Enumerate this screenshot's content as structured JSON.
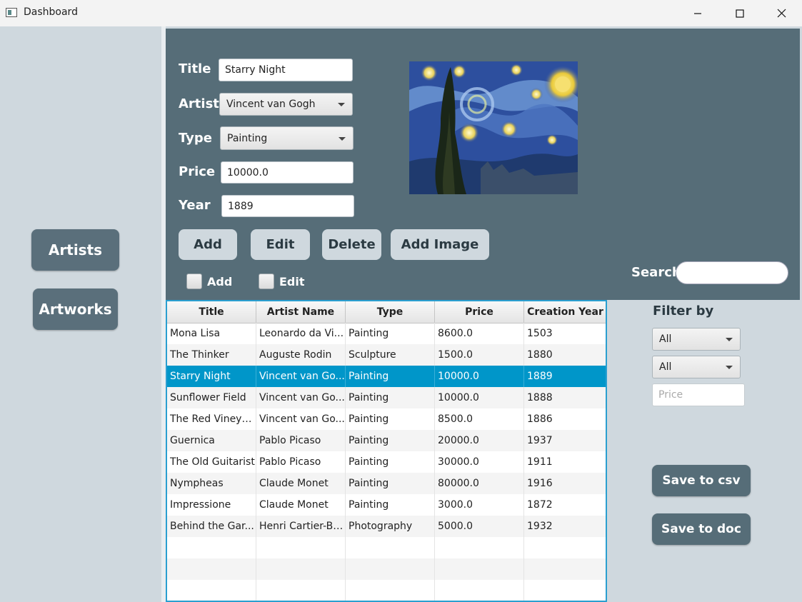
{
  "window": {
    "title": "Dashboard"
  },
  "sidebar": {
    "artists_label": "Artists",
    "artworks_label": "Artworks"
  },
  "form": {
    "title_label": "Title",
    "title_value": "Starry Night",
    "artist_label": "Artist",
    "artist_value": "Vincent van Gogh",
    "type_label": "Type",
    "type_value": "Painting",
    "price_label": "Price",
    "price_value": "10000.0",
    "year_label": "Year",
    "year_value": "1889"
  },
  "actions": {
    "add": "Add",
    "edit": "Edit",
    "delete": "Delete",
    "add_image": "Add Image"
  },
  "checkboxes": {
    "add": "Add",
    "edit": "Edit"
  },
  "search": {
    "label": "Search"
  },
  "table": {
    "headers": [
      "Title",
      "Artist Name",
      "Type",
      "Price",
      "Creation Year"
    ],
    "rows": [
      [
        "Mona Lisa",
        "Leonardo da Vi...",
        "Painting",
        "8600.0",
        "1503"
      ],
      [
        "The Thinker",
        "Auguste Rodin",
        "Sculpture",
        "1500.0",
        "1880"
      ],
      [
        "Starry Night",
        "Vincent van Go...",
        "Painting",
        "10000.0",
        "1889"
      ],
      [
        "Sunflower Field",
        "Vincent van Go...",
        "Painting",
        "10000.0",
        "1888"
      ],
      [
        "The Red Vineyard",
        "Vincent van Go...",
        "Painting",
        "8500.0",
        "1886"
      ],
      [
        "Guernica",
        "Pablo Picaso",
        "Painting",
        "20000.0",
        "1937"
      ],
      [
        "The Old Guitarist",
        "Pablo Picaso",
        "Painting",
        "30000.0",
        "1911"
      ],
      [
        "Nympheas",
        "Claude Monet",
        "Painting",
        "80000.0",
        "1916"
      ],
      [
        "Impressione",
        "Claude Monet",
        "Painting",
        "3000.0",
        "1872"
      ],
      [
        "Behind the Gar...",
        "Henri Cartier-Br...",
        "Photography",
        "5000.0",
        "1932"
      ]
    ],
    "selected_row": 2
  },
  "filter": {
    "label": "Filter by",
    "select1": "All",
    "select2": "All",
    "price_placeholder": "Price"
  },
  "save": {
    "csv": "Save to csv",
    "doc": "Save to doc"
  }
}
